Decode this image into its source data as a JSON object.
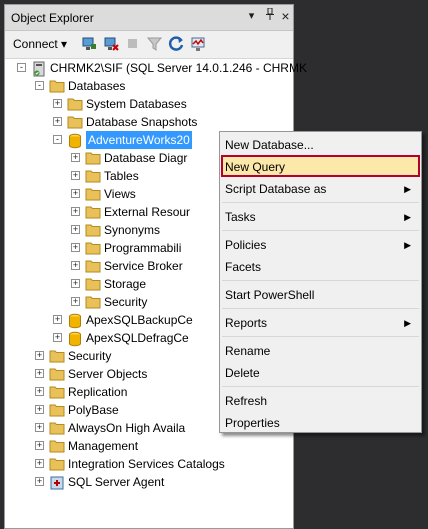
{
  "panel": {
    "title": "Object Explorer",
    "pin_glyph": "▾",
    "dock_glyph": "⊥",
    "close_glyph": "×"
  },
  "toolbar": {
    "connect_label": "Connect ▾"
  },
  "tree": {
    "server": "CHRMK2\\SIF (SQL Server 14.0.1.246 - CHRMK",
    "databases": "Databases",
    "system_databases": "System Databases",
    "database_snapshots": "Database Snapshots",
    "selected_db": "AdventureWorks20",
    "db_children": [
      "Database Diagr",
      "Tables",
      "Views",
      "External Resour",
      "Synonyms",
      "Programmabili",
      "Service Broker",
      "Storage",
      "Security"
    ],
    "other_dbs": [
      "ApexSQLBackupCe",
      "ApexSQLDefragCe"
    ],
    "root_nodes": [
      "Security",
      "Server Objects",
      "Replication",
      "PolyBase",
      "AlwaysOn High Availa",
      "Management",
      "Integration Services Catalogs",
      "SQL Server Agent"
    ]
  },
  "context_menu": {
    "items": [
      {
        "label": "New Database...",
        "submenu": false
      },
      {
        "label": "New Query",
        "submenu": false,
        "highlighted": true
      },
      {
        "label": "Script Database as",
        "submenu": true
      },
      {
        "label": "Tasks",
        "submenu": true
      },
      {
        "label": "Policies",
        "submenu": true
      },
      {
        "label": "Facets",
        "submenu": false
      },
      {
        "label": "Start PowerShell",
        "submenu": false
      },
      {
        "label": "Reports",
        "submenu": true
      },
      {
        "label": "Rename",
        "submenu": false
      },
      {
        "label": "Delete",
        "submenu": false
      },
      {
        "label": "Refresh",
        "submenu": false
      },
      {
        "label": "Properties",
        "submenu": false
      }
    ]
  },
  "colors": {
    "selection": "#3399ff",
    "highlight_border": "#b4002c",
    "highlight_fill": "#fce8a8",
    "folder": "#e8c15a",
    "database": "#f0b400"
  }
}
